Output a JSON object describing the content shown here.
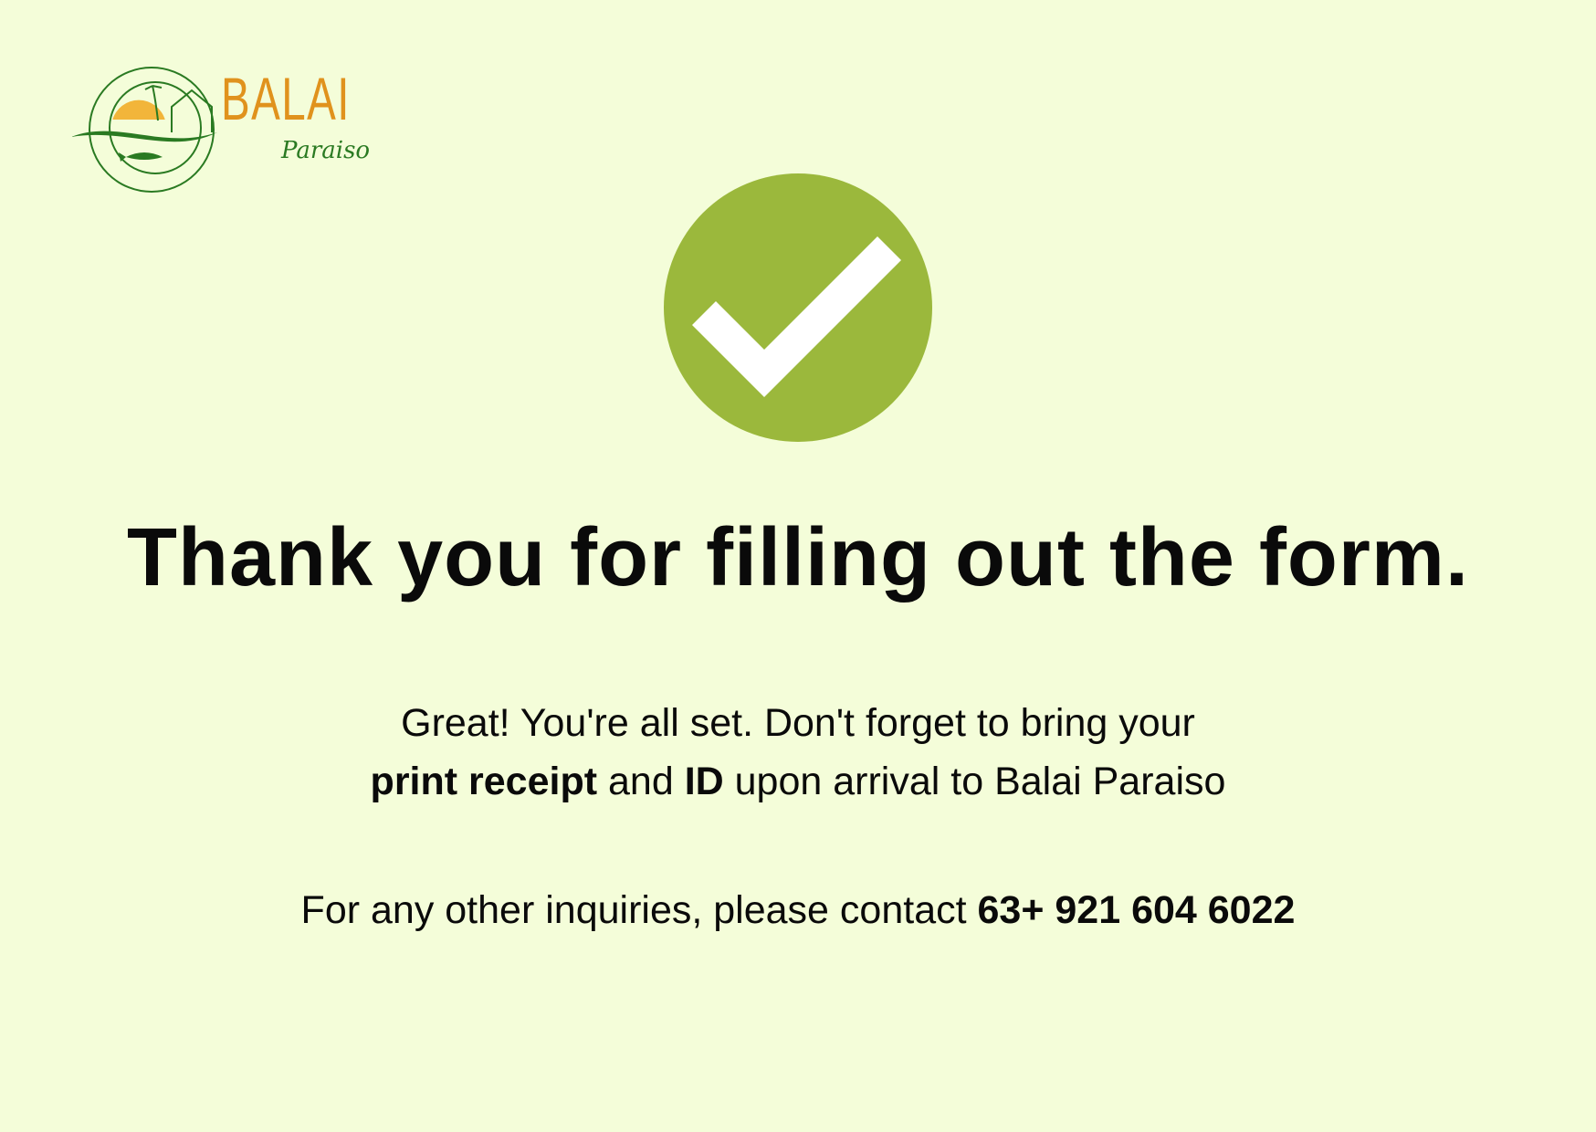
{
  "logo": {
    "name": "BALAI",
    "subtitle": "Paraiso"
  },
  "colors": {
    "background": "#f4fdd9",
    "check": "#9bb83c",
    "brand_orange": "#e0921d",
    "brand_green": "#2a7a22"
  },
  "icon": "check-circle-icon",
  "title": "Thank you for filling out the form.",
  "message": {
    "line1": "Great! You're all set. Don't forget to bring your",
    "bold1": "print receipt",
    "and": " and ",
    "bold2": "ID",
    "rest": " upon arrival to Balai Paraiso"
  },
  "contact": {
    "label": "For any other inquiries, please contact ",
    "phone": "63+ 921 604 6022"
  }
}
